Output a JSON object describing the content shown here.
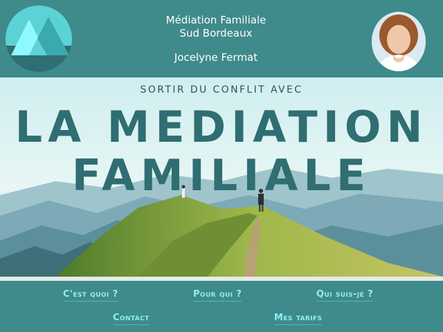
{
  "header": {
    "title_line1": "Médiation Familiale",
    "title_line2": "Sud Bordeaux",
    "person_name": "Jocelyne Fermat",
    "logo_icon": "mountain-logo-icon",
    "portrait_icon": "portrait-photo"
  },
  "hero": {
    "kicker": "SORTIR DU CONFLIT AVEC",
    "headline_line1": "LA MEDIATION",
    "headline_line2": "FAMILIALE"
  },
  "nav": {
    "items": [
      {
        "label": "C'est quoi ?"
      },
      {
        "label": "Pour qui ?"
      },
      {
        "label": "Qui suis-je ?"
      },
      {
        "label": "Contact"
      },
      {
        "label": "Mes tarifs"
      }
    ]
  },
  "colors": {
    "background": "#3f8a8b",
    "logo_circle": "#5bd3d6",
    "headline": "#2f6e72",
    "nav_link": "#8ff0f2"
  }
}
